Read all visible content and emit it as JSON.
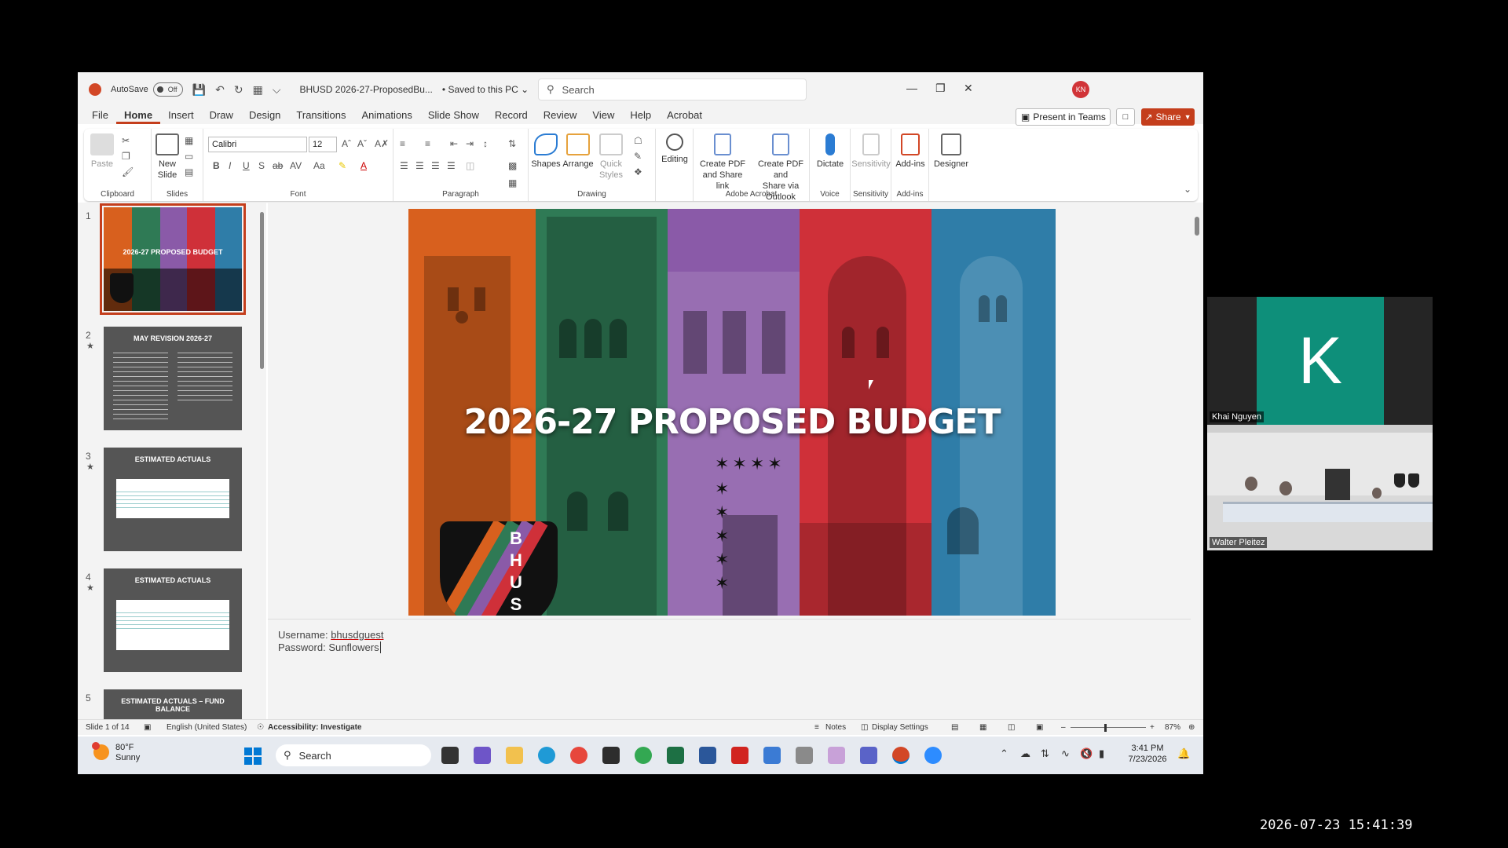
{
  "window": {
    "autosave_label": "AutoSave",
    "autosave_state": "Off",
    "doc_title": "BHUSD 2026-27-ProposedBu...",
    "saved_status": "• Saved to this PC ⌄",
    "search_placeholder": "Search",
    "user_initials": "KN"
  },
  "menu": {
    "tabs": [
      "File",
      "Home",
      "Insert",
      "Draw",
      "Design",
      "Transitions",
      "Animations",
      "Slide Show",
      "Record",
      "Review",
      "View",
      "Help",
      "Acrobat"
    ],
    "active": "Home",
    "present_label": "Present in Teams",
    "share_label": "Share"
  },
  "ribbon": {
    "paste": "Paste",
    "new_slide_1": "New",
    "new_slide_2": "Slide",
    "font_name": "Calibri",
    "font_size": "12",
    "shapes": "Shapes",
    "arrange": "Arrange",
    "quick_styles_1": "Quick",
    "quick_styles_2": "Styles",
    "editing": "Editing",
    "create_pdf_share_1": "Create PDF",
    "create_pdf_share_2": "and Share link",
    "create_pdf_outlook_1": "Create PDF and",
    "create_pdf_outlook_2": "Share via Outlook",
    "dictate": "Dictate",
    "sensitivity": "Sensitivity",
    "addins": "Add-ins",
    "designer": "Designer",
    "groups": {
      "clipboard": "Clipboard",
      "slides": "Slides",
      "font": "Font",
      "paragraph": "Paragraph",
      "drawing": "Drawing",
      "acrobat": "Adobe Acrobat",
      "voice": "Voice",
      "sensitivity": "Sensitivity",
      "addins": "Add-ins"
    }
  },
  "thumbnails": [
    {
      "num": "1",
      "title": "2026-27 PROPOSED BUDGET"
    },
    {
      "num": "2",
      "title": "MAY REVISION 2026-27"
    },
    {
      "num": "3",
      "title": "ESTIMATED ACTUALS"
    },
    {
      "num": "4",
      "title": "ESTIMATED ACTUALS"
    },
    {
      "num": "5",
      "title": "ESTIMATED ACTUALS – FUND BALANCE"
    }
  ],
  "slide": {
    "title": "2026-27 PROPOSED BUDGET",
    "shield_letters": [
      "B",
      "H",
      "U",
      "S"
    ]
  },
  "notes": {
    "username_label": "Username: ",
    "username_value": "bhusdguest",
    "password_label": "Password: ",
    "password_value": "Sunflowers"
  },
  "status": {
    "slide_count": "Slide 1 of 14",
    "language": "English (United States)",
    "accessibility": "Accessibility: Investigate",
    "notes": "Notes",
    "display_settings": "Display Settings",
    "zoom": "87%"
  },
  "taskbar": {
    "temp": "80°F",
    "weather": "Sunny",
    "search": "Search",
    "time": "3:41 PM",
    "date": "7/23/2026"
  },
  "zoom": {
    "participant1_initial": "K",
    "participant1_name": "Khai Nguyen",
    "participant2_name": "Walter Pleitez"
  },
  "recording_timestamp": "2026-07-23 15:41:39",
  "colors": {
    "accent": "#c43e1c",
    "col_orange": "#d8601e",
    "col_green": "#2f7a55",
    "col_purple": "#8a5aa8",
    "col_red": "#cf3039",
    "col_blue": "#2f7da8",
    "zoom_tile": "#0e8f7a"
  }
}
